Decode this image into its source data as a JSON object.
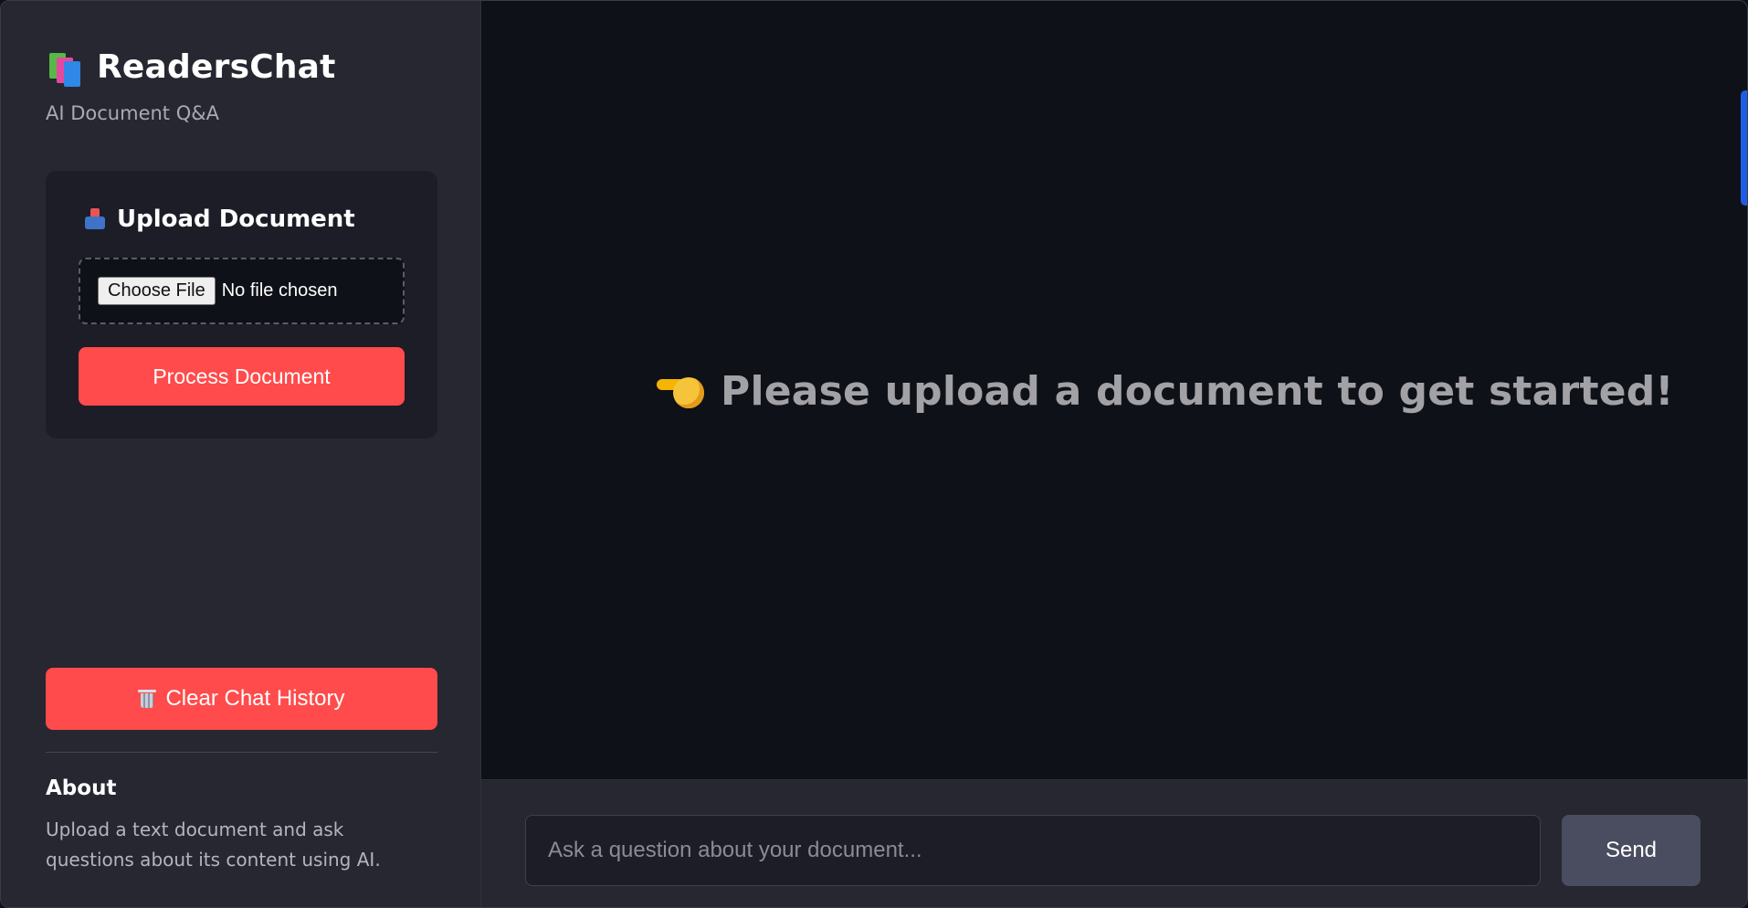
{
  "app": {
    "title": "ReadersChat",
    "subtitle": "AI Document Q&A"
  },
  "upload": {
    "title": "Upload Document",
    "choose_file_label": "Choose File",
    "file_status": "No file chosen",
    "process_label": "Process Document"
  },
  "sidebar_actions": {
    "clear_label": "Clear Chat History"
  },
  "about": {
    "title": "About",
    "text": "Upload a text document and ask questions about its content using AI."
  },
  "main": {
    "prompt": "Please upload a document to get started!"
  },
  "chat": {
    "placeholder": "Ask a question about your document...",
    "send_label": "Send"
  },
  "icons": {
    "brand": "books-icon",
    "upload": "inbox-tray-icon",
    "clear": "wastebasket-icon",
    "prompt": "pointing-hand-icon"
  },
  "colors": {
    "accent": "#ff4b4b",
    "sidebar_background": "#262730",
    "main_background": "#0e1117",
    "send_button": "#4a4d5f"
  }
}
